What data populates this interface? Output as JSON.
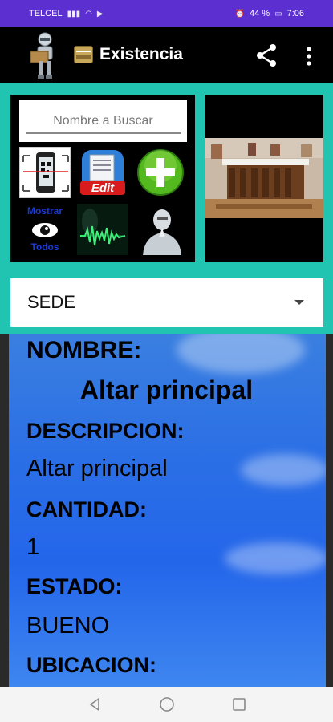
{
  "status_bar": {
    "carrier": "TELCEL",
    "battery": "44 %",
    "time": "7:06"
  },
  "app_bar": {
    "title": "Existencia",
    "icons": [
      "robot-logo-icon",
      "folder-icon",
      "share-icon",
      "more-vert-icon"
    ]
  },
  "search": {
    "placeholder": "Nombre a Buscar"
  },
  "tiles": {
    "qr_icon": "qr-scan-icon",
    "edit_label": "Edit",
    "add_icon": "plus-icon",
    "show_all_line1": "Mostrar",
    "show_all_line2": "Todos",
    "voice_icon": "sound-wave-icon",
    "ai_icon": "robot-pray-icon"
  },
  "spinner": {
    "selected": "SEDE"
  },
  "detail": {
    "nombre_label": "NOMBRE:",
    "nombre_value": "Altar principal",
    "descripcion_label": "DESCRIPCION:",
    "descripcion_value": "Altar principal",
    "cantidad_label": "CANTIDAD:",
    "cantidad_value": "1",
    "estado_label": "ESTADO:",
    "estado_value": "BUENO",
    "ubicacion_label": "UBICACION:"
  },
  "colors": {
    "status_bar": "#5b2fd0",
    "accent_teal": "#21c4b0",
    "detail_blue": "#2b6fe6"
  }
}
